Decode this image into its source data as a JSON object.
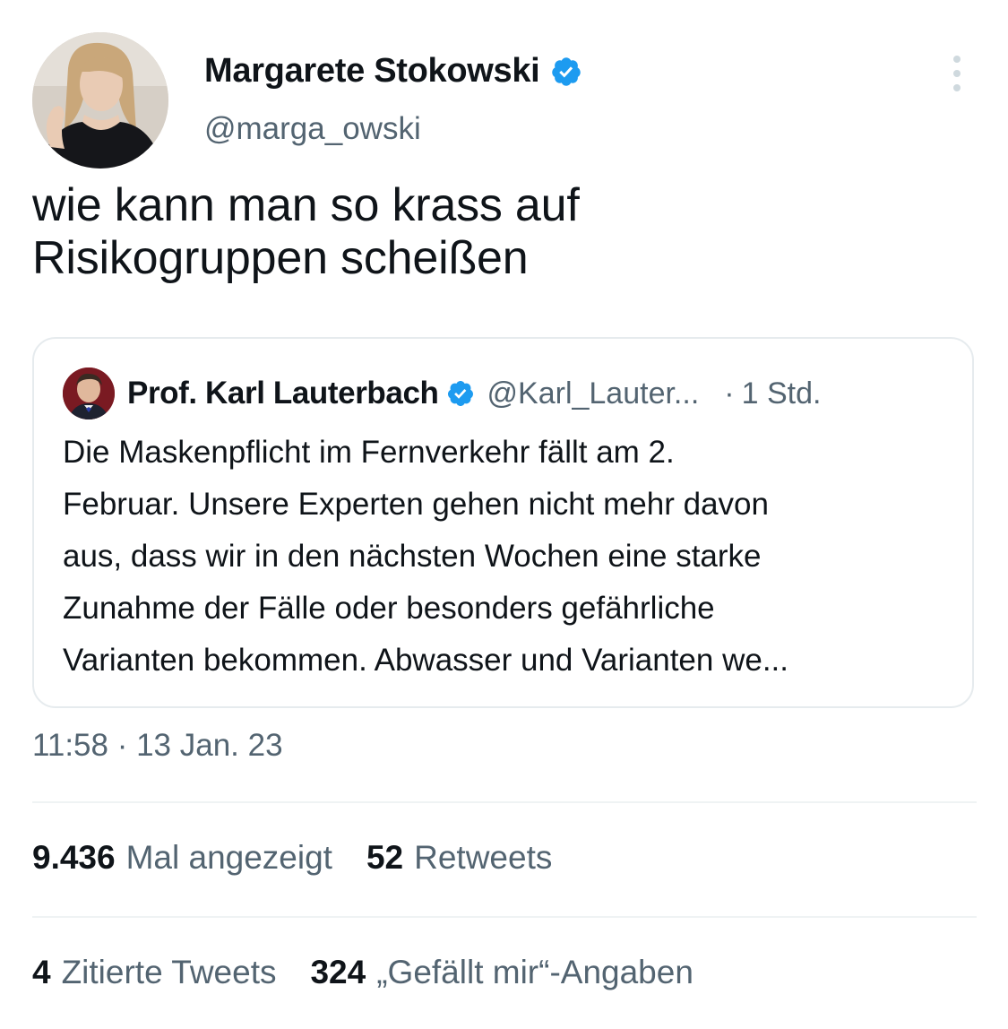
{
  "author": {
    "name": "Margarete Stokowski",
    "handle": "@marga_owski",
    "verified": true
  },
  "tweet": {
    "text": "wie kann man so krass auf\nRisikogruppen scheißen"
  },
  "quoted_tweet": {
    "name": "Prof. Karl Lauterbach",
    "handle": "@Karl_Lauter...",
    "separator": "·",
    "time": "1 Std.",
    "verified": true,
    "text": "Die Maskenpflicht im Fernverkehr fällt am 2.\nFebruar. Unsere Experten gehen nicht mehr davon\naus, dass wir in den nächsten Wochen eine starke\nZunahme der Fälle oder besonders gefährliche\nVarianten bekommen. Abwasser und Varianten we..."
  },
  "timestamp": "11:58 · 13 Jan. 23",
  "stats": {
    "views_count": "9.436",
    "views_label": "Mal angezeigt",
    "retweets_count": "52",
    "retweets_label": "Retweets",
    "quotes_count": "4",
    "quotes_label": "Zitierte Tweets",
    "likes_count": "324",
    "likes_label": "„Gefällt mir“-Angaben"
  },
  "colors": {
    "verified": "#1d9bf0",
    "secondary_text": "#536471",
    "primary_text": "#0f1419",
    "border": "#e6ebee"
  },
  "icons": {
    "verified": "verified-badge-icon",
    "more": "more-options-icon"
  }
}
